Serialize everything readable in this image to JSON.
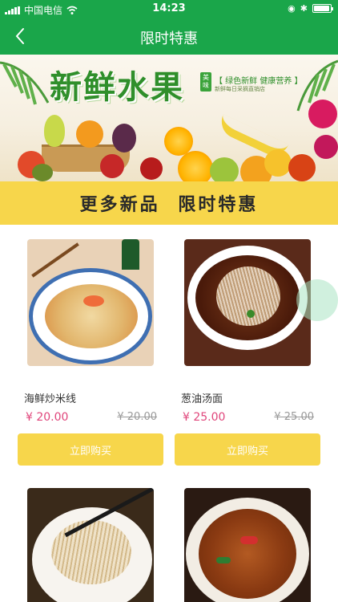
{
  "status_bar": {
    "carrier": "中国电信",
    "time": "14:23",
    "battery_level": 0.95
  },
  "nav": {
    "title": "限时特惠",
    "back_icon": "chevron-left-icon"
  },
  "banner": {
    "title": "新鲜水果",
    "tag": "美味",
    "slogan": "【 绿色新鲜  健康营养 】",
    "subtitle": "新鲜每日采摘直销店"
  },
  "promo": {
    "text": "更多新品 限时特惠"
  },
  "products": [
    {
      "name": "海鲜炒米线",
      "price": "¥ 20.00",
      "original_price": "¥ 20.00",
      "buy_label": "立即购买"
    },
    {
      "name": "葱油汤面",
      "price": "¥ 25.00",
      "original_price": "¥ 25.00",
      "buy_label": "立即购买"
    },
    {
      "name": "",
      "price": "",
      "original_price": "",
      "buy_label": ""
    },
    {
      "name": "",
      "price": "",
      "original_price": "",
      "buy_label": ""
    }
  ],
  "colors": {
    "primary": "#1aa64a",
    "accent": "#f7d64b",
    "price": "#e0457b"
  }
}
